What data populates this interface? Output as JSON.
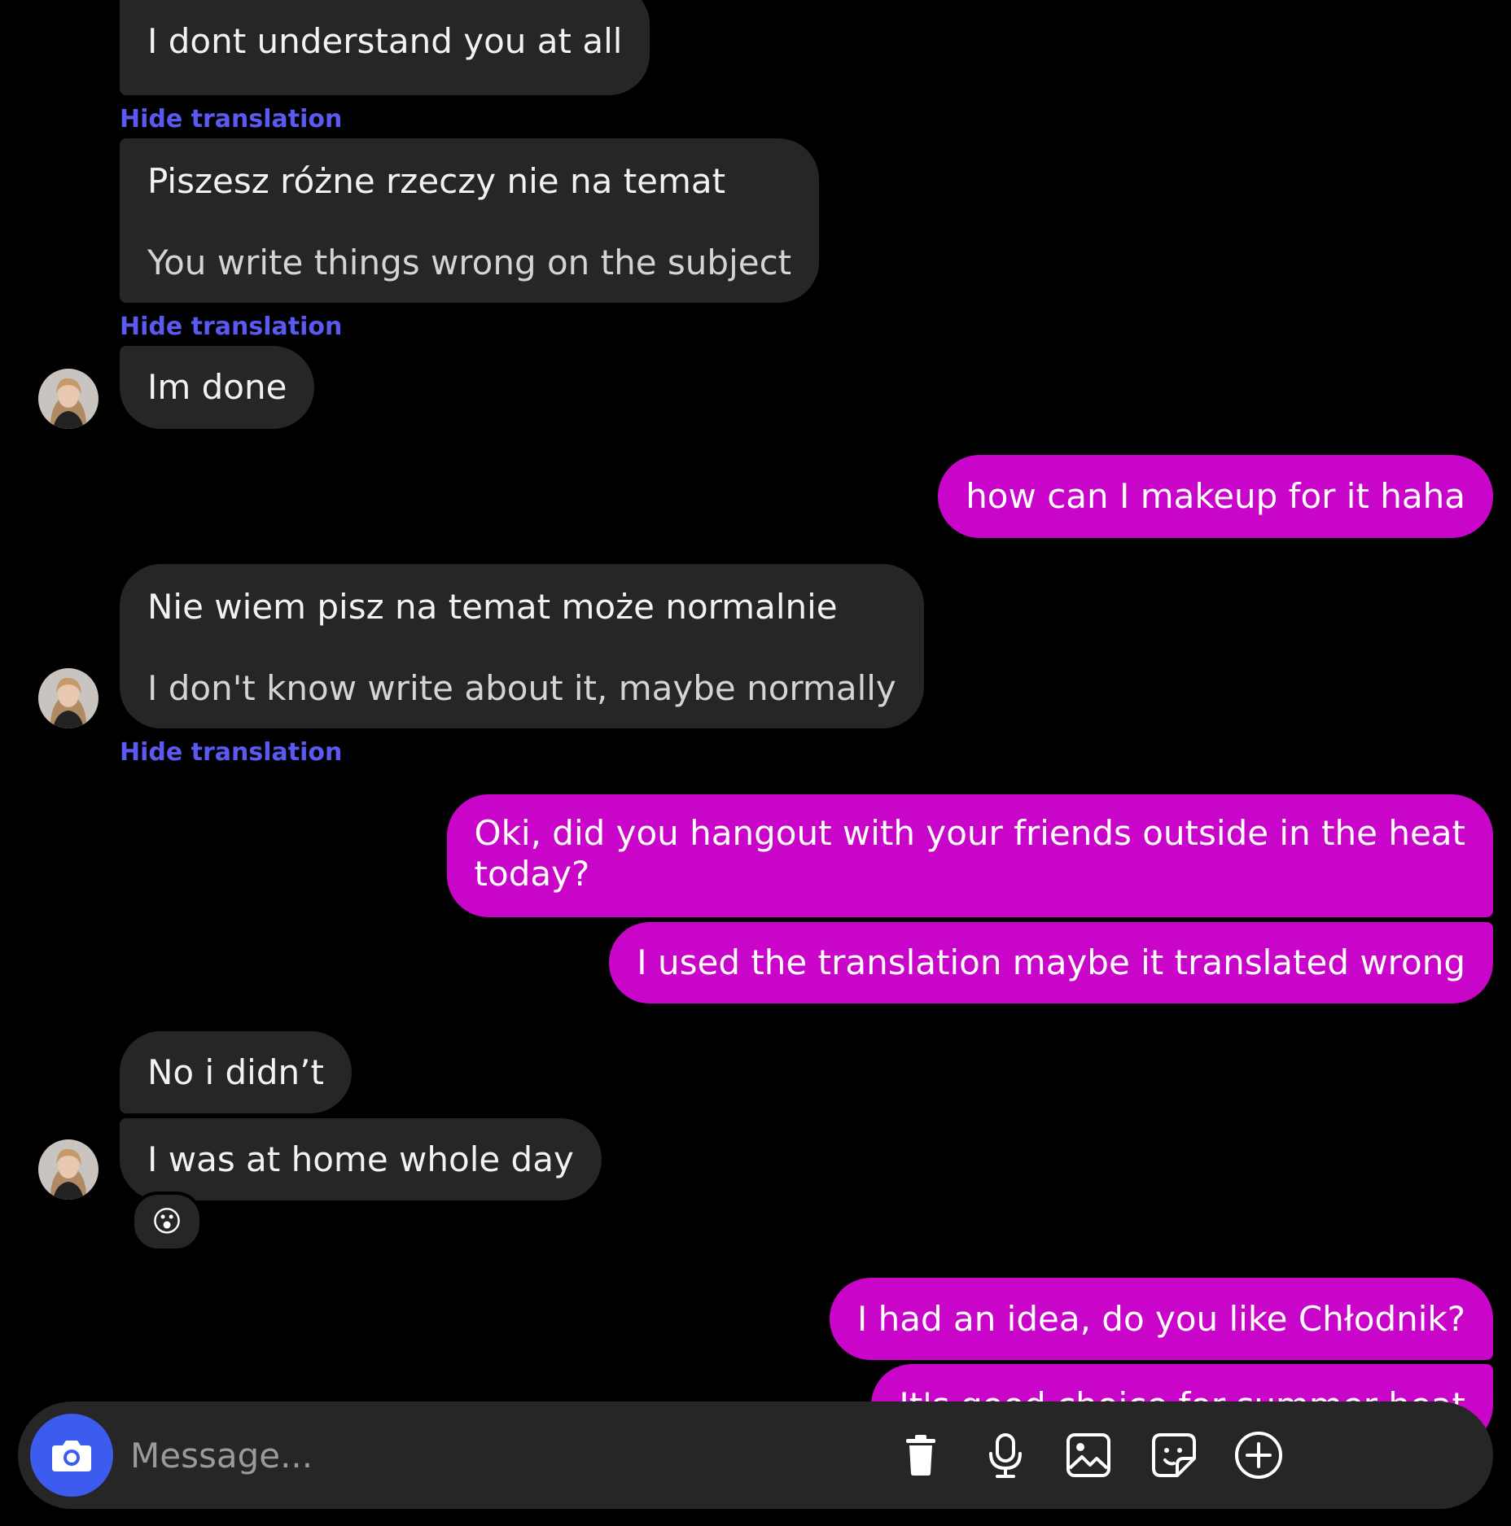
{
  "hide_translation_label": "Hide translation",
  "colors": {
    "background": "#000000",
    "incoming_bubble": "#262626",
    "outgoing_bubble": "#c805c8",
    "link": "#5a5af2",
    "camera_button": "#3c5cf0"
  },
  "messages": [
    {
      "direction": "incoming",
      "text": "I dont understand you at all"
    },
    {
      "direction": "incoming",
      "text": "Piszesz różne rzeczy nie na temat",
      "translation": "You write things wrong on the subject"
    },
    {
      "direction": "incoming",
      "text": "Im done"
    },
    {
      "direction": "outgoing",
      "text": "how can I makeup for it haha"
    },
    {
      "direction": "incoming",
      "text": "Nie wiem pisz na temat może normalnie",
      "translation": "I don't know write about it, maybe normally"
    },
    {
      "direction": "outgoing",
      "text_line1": "Oki, did you hangout with your friends outside in the heat",
      "text_line2": "today?"
    },
    {
      "direction": "outgoing",
      "text": "I used the translation maybe it translated wrong"
    },
    {
      "direction": "incoming",
      "text": "No i didn’t"
    },
    {
      "direction": "incoming",
      "text": "I was at home whole day",
      "reaction": "😮"
    },
    {
      "direction": "outgoing",
      "text": "I had an idea, do you like Chłodnik?"
    },
    {
      "direction": "outgoing",
      "text": "It's good choice for summer heat"
    }
  ],
  "composer": {
    "placeholder": "Message...",
    "icons": [
      "camera-icon",
      "trash-icon",
      "microphone-icon",
      "gallery-icon",
      "sticker-icon",
      "plus-circle-icon"
    ]
  }
}
